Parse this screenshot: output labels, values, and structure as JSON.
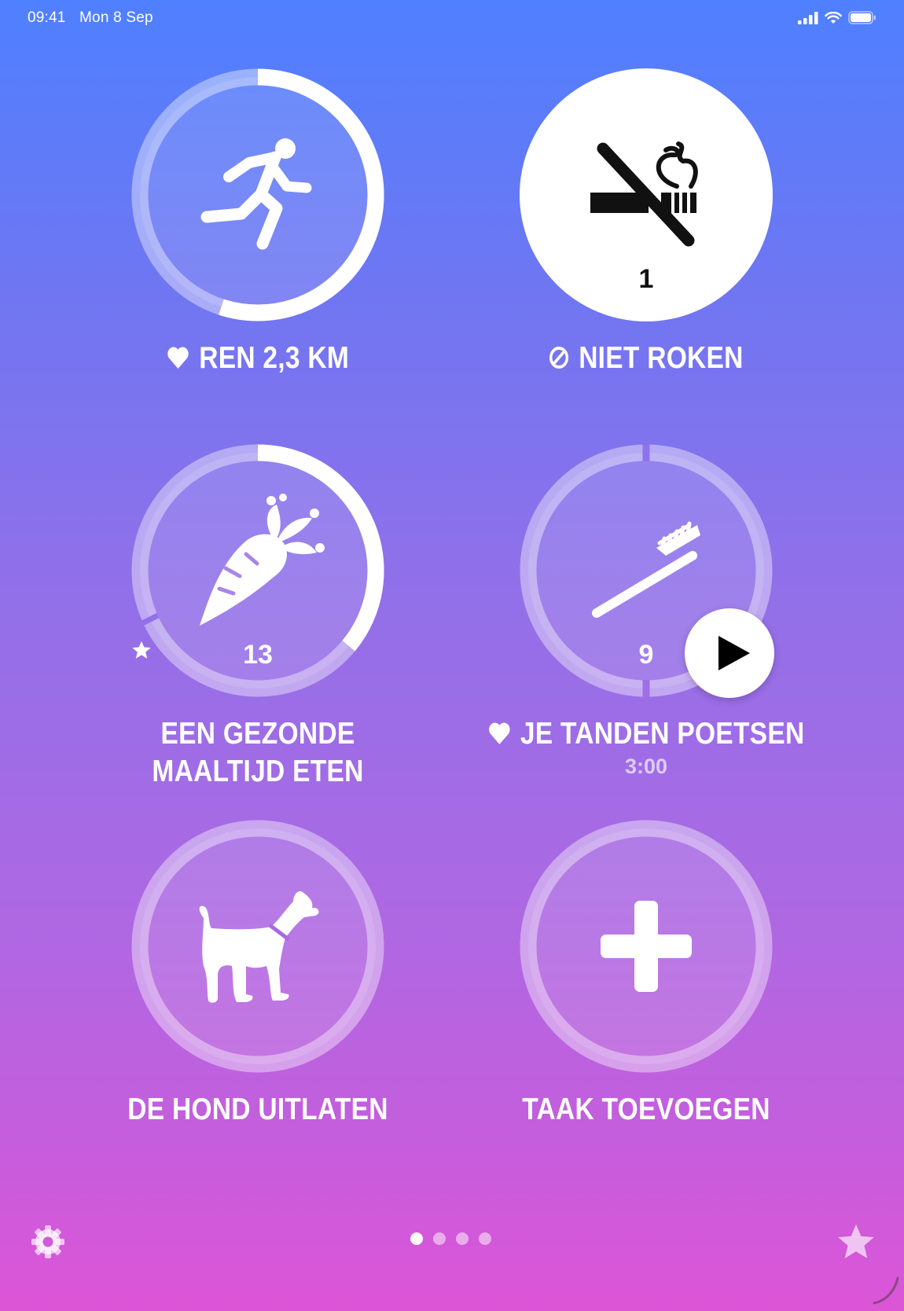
{
  "status_bar": {
    "time": "09:41",
    "date": "Mon 8 Sep"
  },
  "tasks": [
    {
      "name": "run",
      "icon": "running-person-icon",
      "label": "REN 2,3 KM",
      "label_icon": "heart-icon",
      "progress": 0.55,
      "count": ""
    },
    {
      "name": "no-smoking",
      "icon": "no-smoking-icon",
      "label": "NIET ROKEN",
      "label_icon": "prohibited-icon",
      "completed": true,
      "count": "1"
    },
    {
      "name": "healthy-meal",
      "icon": "carrot-icon",
      "label_line1": "EEN GEZONDE",
      "label_line2": "MAALTIJD ETEN",
      "progress": 0.36,
      "count": "13",
      "count_icon": "star-icon"
    },
    {
      "name": "brush-teeth",
      "icon": "toothbrush-icon",
      "label": "JE TANDEN POETSEN",
      "label_icon": "heart-icon",
      "sessions": 2,
      "count": "9",
      "timer": "3:00",
      "action_icon": "play-icon"
    },
    {
      "name": "walk-dog",
      "icon": "dog-icon",
      "label": "DE HOND UITLATEN",
      "progress": 0
    },
    {
      "name": "add-task",
      "icon": "plus-icon",
      "label": "TAAK TOEVOEGEN"
    }
  ],
  "pager": {
    "pages": 4,
    "current": 1
  },
  "toolbar": {
    "settings_icon": "gear-icon",
    "favorites_icon": "star-icon"
  },
  "colors": {
    "completed_fill": "#ffffff",
    "icon_dark": "#111111"
  }
}
